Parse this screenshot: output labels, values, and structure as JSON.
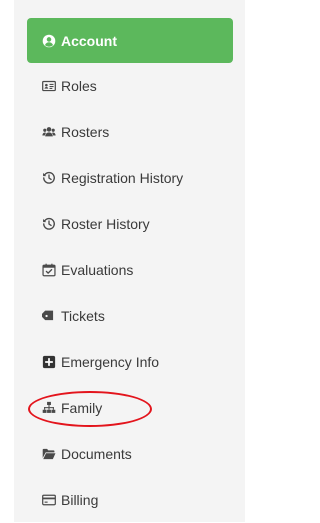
{
  "menu": {
    "items": [
      {
        "label": "Account",
        "icon": "user-circle-icon",
        "active": true
      },
      {
        "label": "Roles",
        "icon": "id-card-icon"
      },
      {
        "label": "Rosters",
        "icon": "users-icon"
      },
      {
        "label": "Registration History",
        "icon": "history-icon"
      },
      {
        "label": "Roster History",
        "icon": "history-icon"
      },
      {
        "label": "Evaluations",
        "icon": "calendar-check-icon"
      },
      {
        "label": "Tickets",
        "icon": "tag-icon"
      },
      {
        "label": "Emergency Info",
        "icon": "plus-square-icon"
      },
      {
        "label": "Family",
        "icon": "sitemap-icon",
        "highlighted": true
      },
      {
        "label": "Documents",
        "icon": "folder-open-icon"
      },
      {
        "label": "Billing",
        "icon": "credit-card-icon"
      }
    ]
  },
  "colors": {
    "active_bg": "#5cb85c",
    "panel_bg": "#f4f4f4",
    "highlight_ring": "#e3141c"
  }
}
